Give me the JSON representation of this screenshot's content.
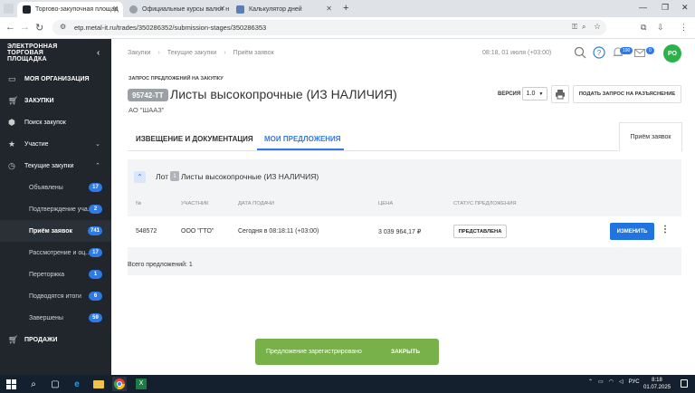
{
  "browser": {
    "tabs": [
      {
        "title": "Торгово-закупочная площад",
        "active": true
      },
      {
        "title": "Официальные курсы валют н",
        "active": false
      },
      {
        "title": "Калькулятор дней",
        "active": false
      }
    ],
    "url": "etp.metal-it.ru/trades/350286352/submission-stages/350286353"
  },
  "sidebar": {
    "logo": [
      "электронная",
      "торговая",
      "площадка"
    ],
    "items": [
      {
        "label": "МОЯ ОРГАНИЗАЦИЯ",
        "icon": "id-card-icon"
      },
      {
        "label": "ЗАКУПКИ",
        "icon": "cart-icon"
      },
      {
        "label": "Поиск закупок",
        "icon": "cube-icon"
      },
      {
        "label": "Участие",
        "icon": "star-icon"
      },
      {
        "label": "Текущие закупки",
        "icon": "clock-icon"
      },
      {
        "label": "Объявлены",
        "badge": "17"
      },
      {
        "label": "Подтверждение уча...",
        "badge": "2"
      },
      {
        "label": "Приём заявок",
        "badge": "741"
      },
      {
        "label": "Рассмотрение и оц...",
        "badge": "17"
      },
      {
        "label": "Переторжка",
        "badge": "1"
      },
      {
        "label": "Подводятся итоги",
        "badge": "6"
      },
      {
        "label": "Завершены",
        "badge": "59"
      },
      {
        "label": "ПРОДАЖИ",
        "icon": "cart-icon"
      }
    ]
  },
  "header": {
    "breadcrumbs": [
      "Закупки",
      "Текущие закупки",
      "Приём заявок"
    ],
    "datetime": "08:18, 01 июля (+03:00)",
    "notifications_count": "190",
    "messages_count": "0",
    "avatar": "РО"
  },
  "procurement": {
    "label": "ЗАПРОС ПРЕДЛОЖЕНИЙ НА ЗАКУПКУ",
    "code": "95742-ТТ",
    "title": "Листы высокопрочные (ИЗ НАЛИЧИЯ)",
    "organization": "АО \"ШААЗ\"",
    "version_label": "ВЕРСИЯ",
    "version": "1.0",
    "ask_button": "ПОДАТЬ ЗАПРОС НА РАЗЪЯСНЕНИЕ"
  },
  "tabs": {
    "notice": "ИЗВЕЩЕНИЕ И ДОКУМЕНТАЦИЯ",
    "my_offers": "МОИ ПРЕДЛОЖЕНИЯ",
    "reception": "Приём заявок"
  },
  "lot": {
    "label": "Лот",
    "number": "1",
    "name": "Листы высокопрочные (ИЗ НАЛИЧИЯ)",
    "columns": [
      "№",
      "УЧАСТНИК",
      "ДАТА ПОДАЧИ",
      "ЦЕНА",
      "СТАТУС ПРЕДЛОЖЕНИЯ"
    ],
    "rows": [
      {
        "num": "548572",
        "participant": "ООО \"ГТО\"",
        "date": "Сегодня в 08:18:11 (+03:00)",
        "price": "3 039 964,17 ₽",
        "status": "ПРЕДСТАВЛЕНА",
        "action": "ИЗМЕНИТЬ"
      }
    ],
    "total": "Всего предложений: 1"
  },
  "toast": {
    "message": "Предложение зарегистрировано",
    "close": "ЗАКРЫТЬ"
  },
  "taskbar": {
    "lang": "РУС",
    "time": "8:18",
    "date": "01.07.2025"
  },
  "colors": {
    "accent": "#2f7be5",
    "sidebar_bg": "#21262d",
    "toast_bg": "#78b04a",
    "avatar_bg": "#2bb34a"
  }
}
